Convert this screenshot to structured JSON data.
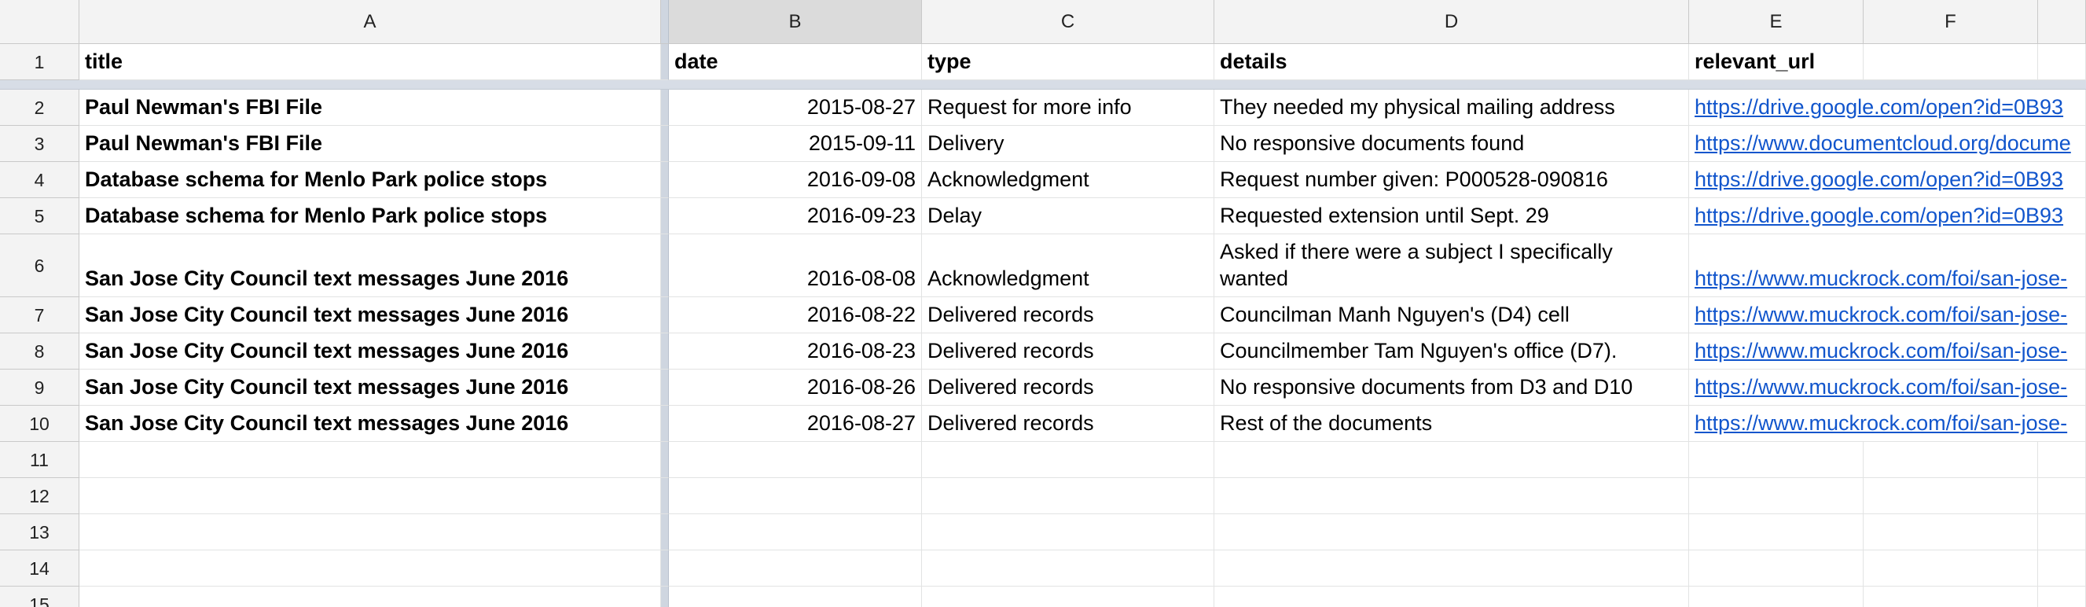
{
  "column_letters": [
    "A",
    "B",
    "C",
    "D",
    "E",
    "F"
  ],
  "selected_column": "B",
  "header_row": {
    "num": "1",
    "title": "title",
    "date": "date",
    "type": "type",
    "details": "details",
    "relevant_url": "relevant_url"
  },
  "rows": [
    {
      "num": "2",
      "title": "Paul Newman's FBI File",
      "date": "2015-08-27",
      "type": "Request for more info",
      "details": "They needed my physical mailing address",
      "url": "https://drive.google.com/open?id=0B93"
    },
    {
      "num": "3",
      "title": "Paul Newman's FBI File",
      "date": "2015-09-11",
      "type": "Delivery",
      "details": "No responsive documents found",
      "url": "https://www.documentcloud.org/docume"
    },
    {
      "num": "4",
      "title": "Database schema for Menlo Park police stops",
      "date": "2016-09-08",
      "type": "Acknowledgment",
      "details": "Request number given: P000528-090816",
      "url": "https://drive.google.com/open?id=0B93"
    },
    {
      "num": "5",
      "title": "Database schema for Menlo Park police stops",
      "date": "2016-09-23",
      "type": "Delay",
      "details": "Requested extension until Sept. 29",
      "url": "https://drive.google.com/open?id=0B93"
    },
    {
      "num": "6",
      "title": "San Jose City Council text messages June 2016",
      "date": "2016-08-08",
      "type": "Acknowledgment",
      "details": "Asked if there were a subject I specifically wanted",
      "url": "https://www.muckrock.com/foi/san-jose-"
    },
    {
      "num": "7",
      "title": "San Jose City Council text messages June 2016",
      "date": "2016-08-22",
      "type": "Delivered records",
      "details": "Councilman Manh Nguyen's (D4) cell",
      "url": "https://www.muckrock.com/foi/san-jose-"
    },
    {
      "num": "8",
      "title": "San Jose City Council text messages June 2016",
      "date": "2016-08-23",
      "type": "Delivered records",
      "details": "Councilmember Tam Nguyen's office (D7).",
      "url": "https://www.muckrock.com/foi/san-jose-"
    },
    {
      "num": "9",
      "title": "San Jose City Council text messages June 2016",
      "date": "2016-08-26",
      "type": "Delivered records",
      "details": "No responsive documents from D3 and D10",
      "url": "https://www.muckrock.com/foi/san-jose-"
    },
    {
      "num": "10",
      "title": "San Jose City Council text messages June 2016",
      "date": "2016-08-27",
      "type": "Delivered records",
      "details": "Rest of the documents",
      "url": "https://www.muckrock.com/foi/san-jose-"
    }
  ],
  "empty_rows": [
    "11",
    "12",
    "13",
    "14",
    "15"
  ],
  "colors": {
    "link": "#1155cc",
    "header_bg": "#f3f3f3",
    "selected_header_bg": "#dbdbdb",
    "freeze_bar": "#d7dde6",
    "grid": "#e2e3e3"
  }
}
